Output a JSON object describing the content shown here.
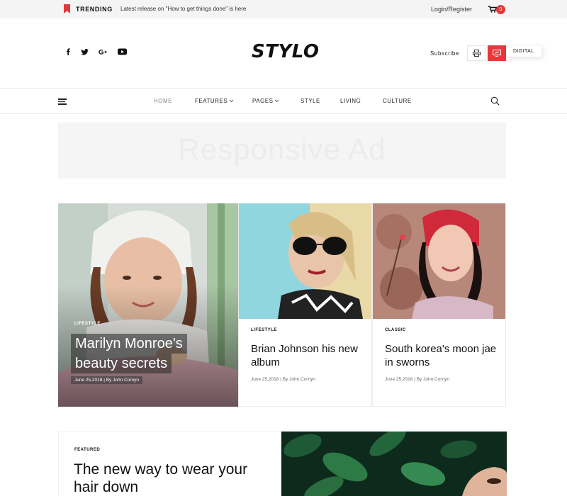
{
  "topbar": {
    "trending_label": "TRENDING",
    "trending_text": "Latest release on \"How to get things done\" is here",
    "login_label": "Login/Register",
    "cart_count": "0",
    "accent_color": "#e0393b"
  },
  "header": {
    "logo": "STYLO",
    "social_icons": [
      "facebook-icon",
      "twitter-icon",
      "google-plus-icon",
      "youtube-icon"
    ],
    "subscribe_label": "Subscribe",
    "digital_label": "DIGITAL"
  },
  "nav": {
    "items": [
      {
        "label": "HOME",
        "has_dropdown": false
      },
      {
        "label": "FEATURES",
        "has_dropdown": true
      },
      {
        "label": "PAGES",
        "has_dropdown": true
      },
      {
        "label": "STYLE",
        "has_dropdown": false
      },
      {
        "label": "LIVING",
        "has_dropdown": false
      },
      {
        "label": "CULTURE",
        "has_dropdown": false
      }
    ]
  },
  "ad": {
    "text": "Responsive Ad"
  },
  "hero": {
    "main": {
      "category": "LIFESTYLE",
      "title_line1": "Marilyn Monroe's",
      "title_line2": "beauty secrets",
      "meta": "June 25,2018 | By John Cornyn"
    },
    "cards": [
      {
        "category": "LIFESTYLE",
        "title": "Brian Johnson his new album",
        "meta": "June 25,2018 | By John Cornyn"
      },
      {
        "category": "CLASSIC",
        "title": "South korea's moon jae in sworns",
        "meta": "June 25,2018 | By John Cornyn"
      }
    ]
  },
  "featured": {
    "category": "FEATURED",
    "title": "The new way to wear your hair down"
  }
}
